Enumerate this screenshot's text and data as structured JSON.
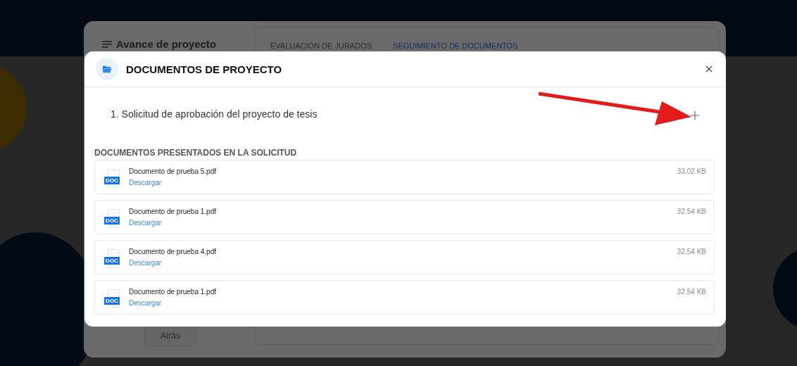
{
  "background_page": {
    "sidebar_title": "Avance de proyecto",
    "back_button": "Atrás",
    "tabs": [
      {
        "label": "EVALUACIÓN DE JURADOS",
        "selected": false
      },
      {
        "label": "SEGUIMIENTO DE DOCUMENTOS",
        "selected": true
      }
    ]
  },
  "dialog": {
    "title": "DOCUMENTOS DE PROYECTO",
    "request": {
      "label": "1. Solicitud de aprobación del proyecto de tesis"
    },
    "section_heading": "DOCUMENTOS PRESENTADOS EN LA SOLICITUD",
    "documents": [
      {
        "name": "Documento de prueba 5.pdf",
        "link": "Descargar",
        "size": "33.02 KB",
        "icon_label": "DOC"
      },
      {
        "name": "Documento de prueba 1.pdf",
        "link": "Descargar",
        "size": "32.54 KB",
        "icon_label": "DOC"
      },
      {
        "name": "Documento de prueba 4.pdf",
        "link": "Descargar",
        "size": "32.54 KB",
        "icon_label": "DOC"
      },
      {
        "name": "Documento de prueba 1.pdf",
        "link": "Descargar",
        "size": "32.54 KB",
        "icon_label": "DOC"
      }
    ]
  }
}
